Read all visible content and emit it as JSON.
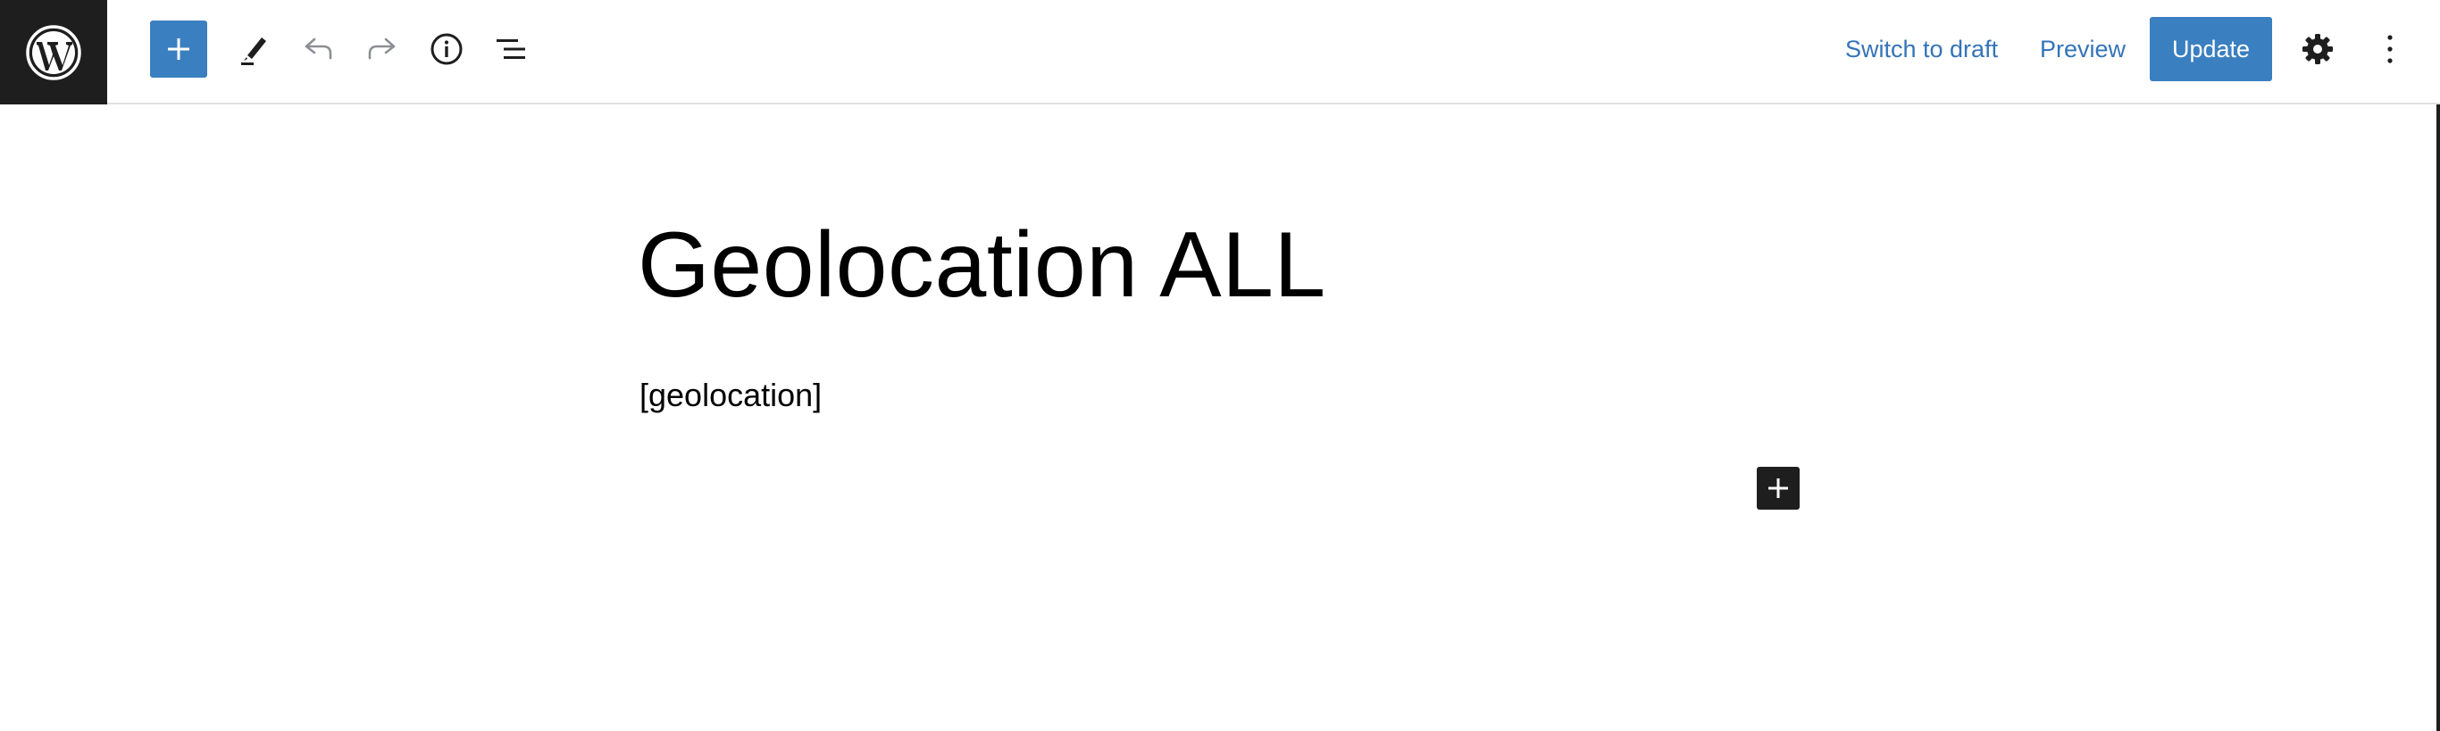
{
  "toolbar": {
    "logo_icon": "wordpress-icon",
    "add_block_icon": "plus-icon",
    "tools_icon": "pencil-icon",
    "undo_icon": "undo-icon",
    "redo_icon": "redo-icon",
    "details_icon": "info-icon",
    "list_view_icon": "list-view-icon",
    "switch_to_draft_label": "Switch to draft",
    "preview_label": "Preview",
    "update_label": "Update",
    "settings_icon": "gear-icon",
    "options_icon": "more-vertical-icon"
  },
  "editor": {
    "title": "Geolocation ALL",
    "paragraph": "[geolocation]",
    "inserter_icon": "plus-icon"
  },
  "colors": {
    "accent": "#3a7fc0",
    "link": "#3474b8",
    "dark": "#1e1e1e"
  }
}
